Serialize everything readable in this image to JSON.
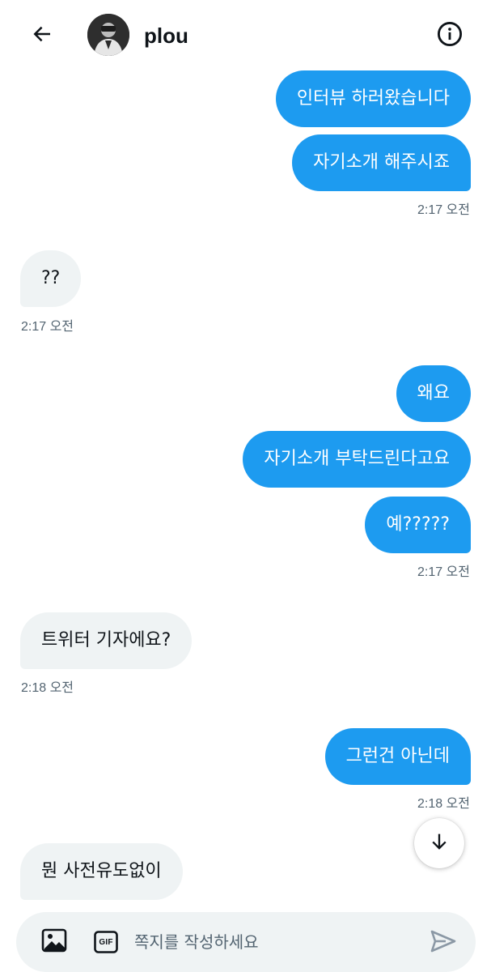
{
  "header": {
    "username": "plou",
    "back_icon": "arrow-left-icon",
    "info_icon": "info-circle-icon"
  },
  "messages": [
    {
      "text": "인터뷰 하러왔습니다",
      "direction": "outgoing"
    },
    {
      "text": "자기소개 해주시죠",
      "direction": "outgoing"
    },
    {
      "time": "2:17 오전",
      "direction": "outgoing"
    },
    {
      "text": "??",
      "direction": "incoming"
    },
    {
      "time": "2:17 오전",
      "direction": "incoming"
    },
    {
      "text": "왜요",
      "direction": "outgoing"
    },
    {
      "text": "자기소개 부탁드린다고요",
      "direction": "outgoing"
    },
    {
      "text": "예?????",
      "direction": "outgoing"
    },
    {
      "time": "2:17 오전",
      "direction": "outgoing"
    },
    {
      "text": "트위터 기자에요?",
      "direction": "incoming"
    },
    {
      "time": "2:18 오전",
      "direction": "incoming"
    },
    {
      "text": "그런건 아닌데",
      "direction": "outgoing"
    },
    {
      "time": "2:18 오전",
      "direction": "outgoing"
    },
    {
      "text": "뭔 사전유도없이",
      "direction": "incoming"
    }
  ],
  "scroll_down_icon": "arrow-down-icon",
  "composer": {
    "placeholder": "쪽지를 작성하세요",
    "media_icon": "image-icon",
    "gif_icon": "gif-icon",
    "gif_label": "GIF",
    "send_icon": "send-icon"
  },
  "colors": {
    "accent": "#1d9bf0",
    "incoming_bubble": "#eff3f4",
    "timestamp": "#536471",
    "text": "#0f1419"
  }
}
